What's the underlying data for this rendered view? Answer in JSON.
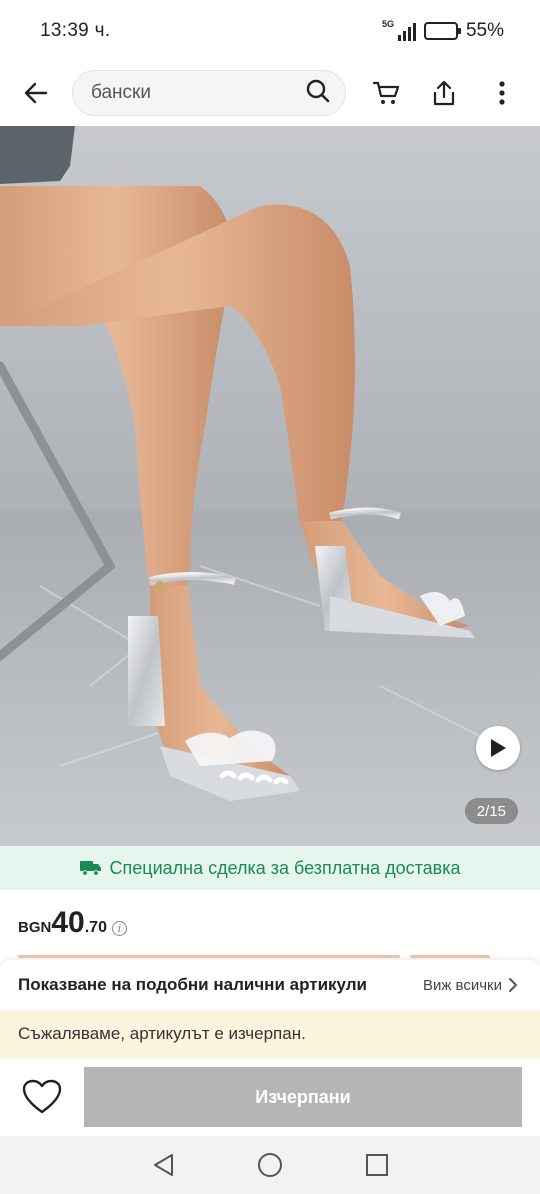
{
  "status_bar": {
    "time": "13:39 ч.",
    "network": "5G",
    "battery": "55%"
  },
  "header": {
    "search_value": "бански",
    "icons": [
      "back-arrow-icon",
      "search-icon",
      "cart-icon",
      "share-icon",
      "more-icon"
    ]
  },
  "gallery": {
    "counter": "2/15",
    "current_index": 2,
    "total": 15
  },
  "shipping": {
    "text": "Специална сделка за безплатна доставка",
    "color": "#1a8a52"
  },
  "price": {
    "currency": "BGN",
    "main": "40",
    "decimal": ".70"
  },
  "similar": {
    "title": "Показване на подобни налични артикули",
    "view_all": "Виж всички"
  },
  "notice": {
    "text": "Съжаляваме, артикулът е изчерпан."
  },
  "action": {
    "button": "Изчерпани"
  }
}
